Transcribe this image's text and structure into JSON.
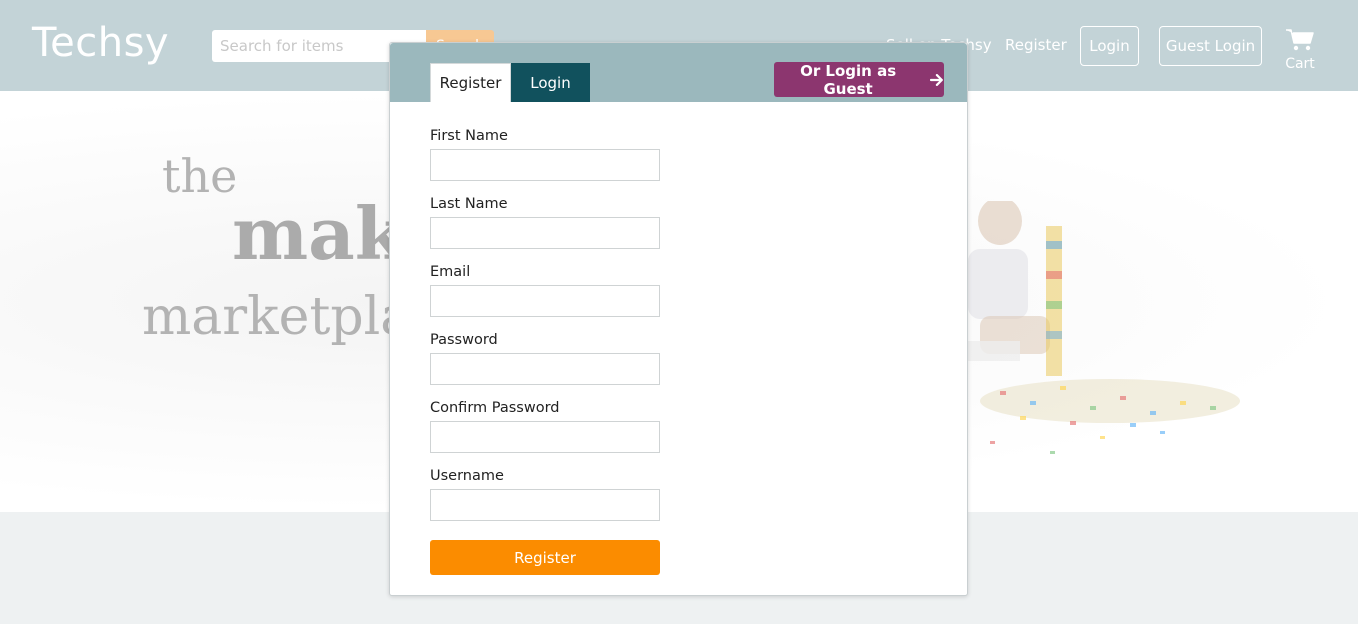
{
  "header": {
    "logo": "Techsy",
    "search_placeholder": "Search for items",
    "search_button": "Search",
    "nav": {
      "sell": "Sell on Techsy",
      "register": "Register",
      "login": "Login",
      "guest_login": "Guest Login",
      "cart": "Cart"
    }
  },
  "hero": {
    "line1": "the",
    "line2": "maker",
    "line3": "marketplace"
  },
  "modal": {
    "tabs": {
      "register": "Register",
      "login": "Login"
    },
    "guest_button": "Or Login as Guest",
    "fields": [
      {
        "label": "First Name",
        "value": ""
      },
      {
        "label": "Last Name",
        "value": ""
      },
      {
        "label": "Email",
        "value": ""
      },
      {
        "label": "Password",
        "value": ""
      },
      {
        "label": "Confirm Password",
        "value": ""
      },
      {
        "label": "Username",
        "value": ""
      }
    ],
    "submit": "Register"
  },
  "colors": {
    "header_bg": "#c3d3d7",
    "modal_header_bg": "#9bb8bd",
    "login_tab": "#11515d",
    "guest_button": "#8c366f",
    "submit_button": "#fb8c00"
  }
}
